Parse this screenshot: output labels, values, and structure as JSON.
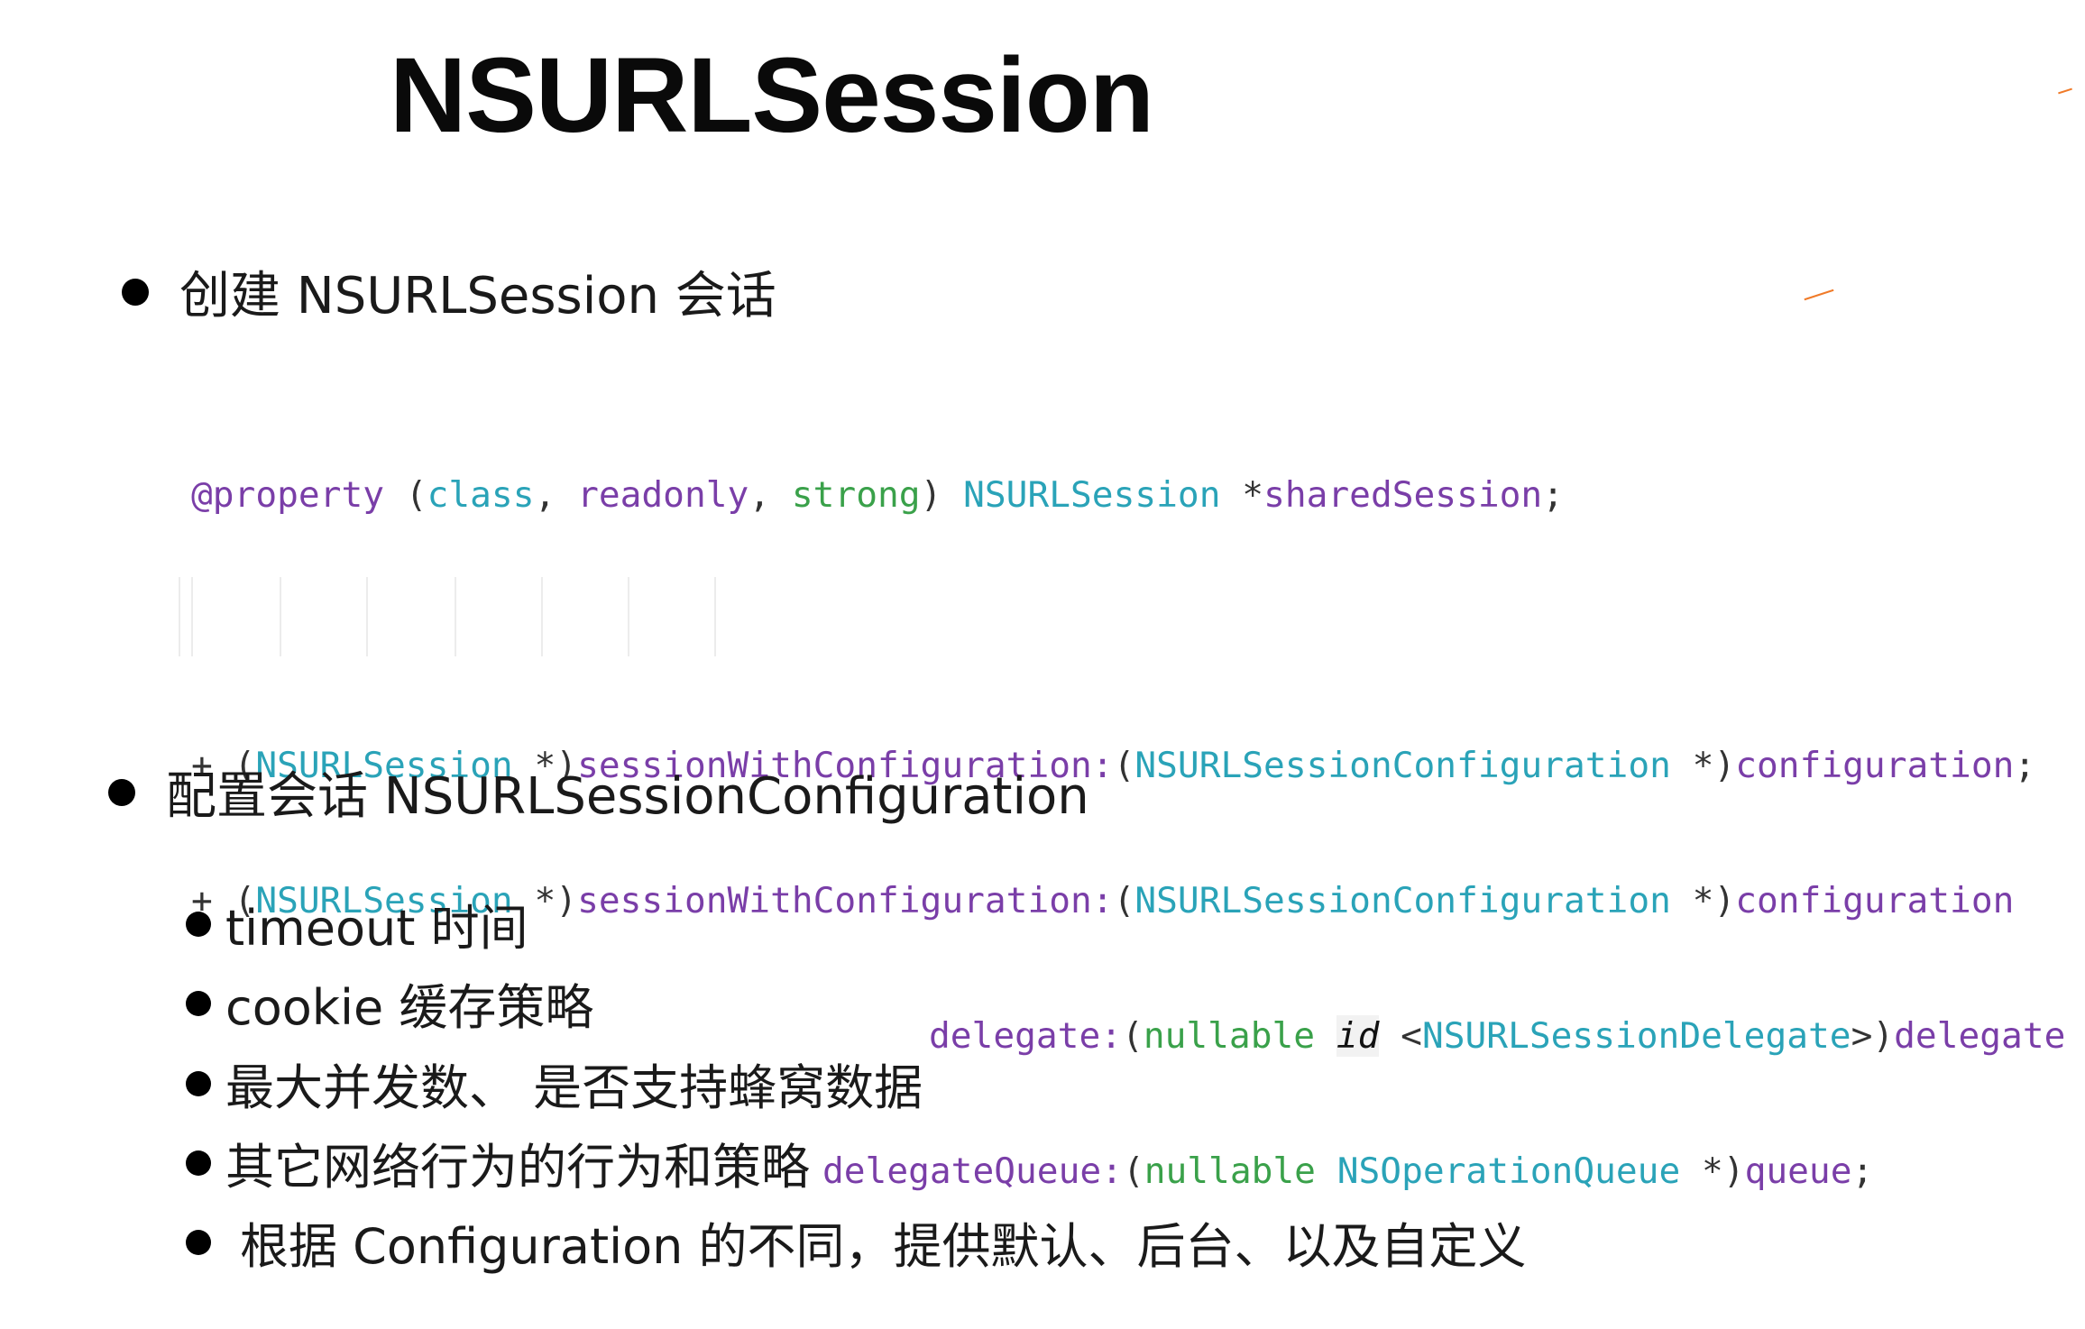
{
  "title": "NSURLSession",
  "section1": {
    "label": "创建 NSURLSession 会话"
  },
  "code": {
    "line1": {
      "at_property": "@property",
      "open": " (",
      "class_kw": "class",
      "comma1": ", ",
      "readonly_kw": "readonly",
      "comma2": ", ",
      "strong_kw": "strong",
      "close": ") ",
      "type": "NSURLSession",
      "star": " *",
      "name": "sharedSession",
      "semi": ";"
    },
    "line2": {
      "plus": "+ (",
      "ret": "NSURLSession",
      "star": " *)",
      "sel": "sessionWithConfiguration:",
      "open": "(",
      "ptype": "NSURLSessionConfiguration",
      "pstar": " *)",
      "pname": "configuration",
      "semi": ";"
    },
    "line3": {
      "plus": "+ (",
      "ret": "NSURLSession",
      "star": " *)",
      "sel": "sessionWithConfiguration:",
      "open": "(",
      "ptype": "NSURLSessionConfiguration",
      "pstar": " *)",
      "pname": "configuration"
    },
    "line4": {
      "sel": "delegate:",
      "open": "(",
      "nullable": "nullable ",
      "id": "id",
      "lt": " <",
      "proto": "NSURLSessionDelegate",
      "gt": ">)",
      "pname": "delegate"
    },
    "line5": {
      "sel": "delegateQueue:",
      "open": "(",
      "nullable": "nullable ",
      "ptype": "NSOperationQueue",
      "pstar": " *)",
      "pname": "queue",
      "semi": ";"
    }
  },
  "section2": {
    "label": "配置会话 NSURLSessionConfiguration",
    "items": [
      "timeout 时间",
      "cookie 缓存策略",
      "最大并发数、 是否支持蜂窝数据",
      "其它网络行为的行为和策略",
      "根据 Configuration 的不同，提供默认、后台、以及自定义"
    ]
  },
  "colors": {
    "keyword": "#7a3ea8",
    "class": "#2aa3b8",
    "strong": "#3aa14a",
    "text": "#1a1a1a"
  }
}
